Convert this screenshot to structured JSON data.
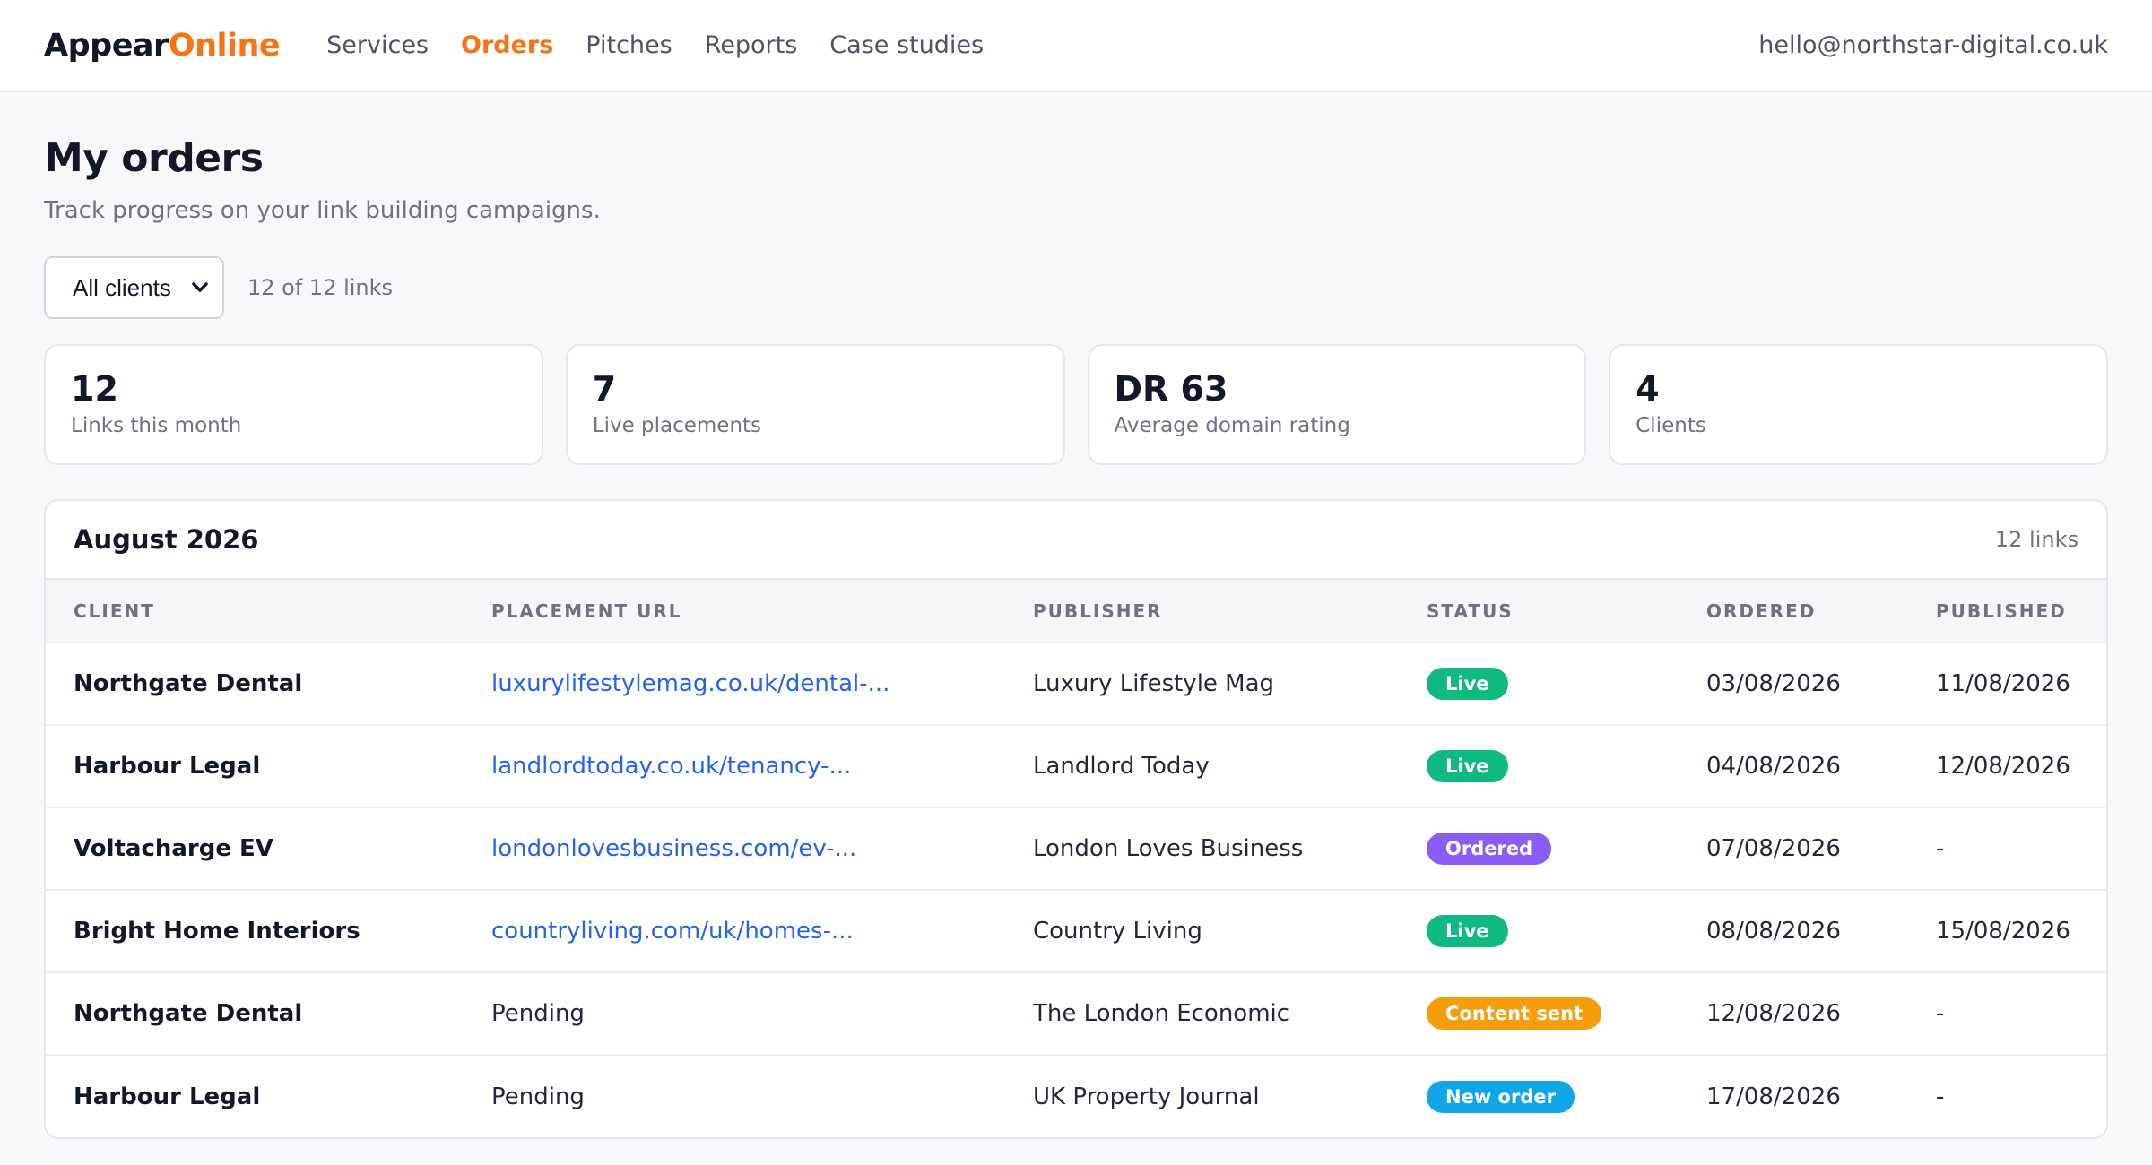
{
  "brand": {
    "name_main": "Appear",
    "name_accent": "Online",
    "accent_color": "#f97316"
  },
  "nav": {
    "items": [
      {
        "label": "Services",
        "active": false
      },
      {
        "label": "Orders",
        "active": true
      },
      {
        "label": "Pitches",
        "active": false
      },
      {
        "label": "Reports",
        "active": false
      },
      {
        "label": "Case studies",
        "active": false
      }
    ],
    "user_email": "hello@northstar-digital.co.uk"
  },
  "page": {
    "title": "My orders",
    "subtitle": "Track progress on your link building campaigns.",
    "filter": {
      "selected": "All clients",
      "count_text": "12 of 12 links"
    }
  },
  "stats": [
    {
      "value": "12",
      "label": "Links this month"
    },
    {
      "value": "7",
      "label": "Live placements"
    },
    {
      "value": "DR 63",
      "label": "Average domain rating"
    },
    {
      "value": "4",
      "label": "Clients"
    }
  ],
  "orders": {
    "month": "August 2026",
    "count_text": "12 links",
    "columns": [
      "CLIENT",
      "PLACEMENT URL",
      "PUBLISHER",
      "STATUS",
      "ORDERED",
      "PUBLISHED"
    ],
    "status_colors": {
      "Live": "#10b981",
      "Ordered": "#8b5cf6",
      "Content sent": "#f59e0b",
      "New order": "#0ea5e9"
    },
    "rows": [
      {
        "client": "Northgate Dental",
        "url": "luxurylifestylemag.co.uk/dental-...",
        "url_is_link": true,
        "publisher": "Luxury Lifestyle Mag",
        "status": "Live",
        "ordered": "03/08/2026",
        "published": "11/08/2026"
      },
      {
        "client": "Harbour Legal",
        "url": "landlordtoday.co.uk/tenancy-...",
        "url_is_link": true,
        "publisher": "Landlord Today",
        "status": "Live",
        "ordered": "04/08/2026",
        "published": "12/08/2026"
      },
      {
        "client": "Voltacharge EV",
        "url": "londonlovesbusiness.com/ev-...",
        "url_is_link": true,
        "publisher": "London Loves Business",
        "status": "Ordered",
        "ordered": "07/08/2026",
        "published": "-"
      },
      {
        "client": "Bright Home Interiors",
        "url": "countryliving.com/uk/homes-...",
        "url_is_link": true,
        "publisher": "Country Living",
        "status": "Live",
        "ordered": "08/08/2026",
        "published": "15/08/2026"
      },
      {
        "client": "Northgate Dental",
        "url": "Pending",
        "url_is_link": false,
        "publisher": "The London Economic",
        "status": "Content sent",
        "ordered": "12/08/2026",
        "published": "-"
      },
      {
        "client": "Harbour Legal",
        "url": "Pending",
        "url_is_link": false,
        "publisher": "UK Property Journal",
        "status": "New order",
        "ordered": "17/08/2026",
        "published": "-"
      }
    ]
  }
}
